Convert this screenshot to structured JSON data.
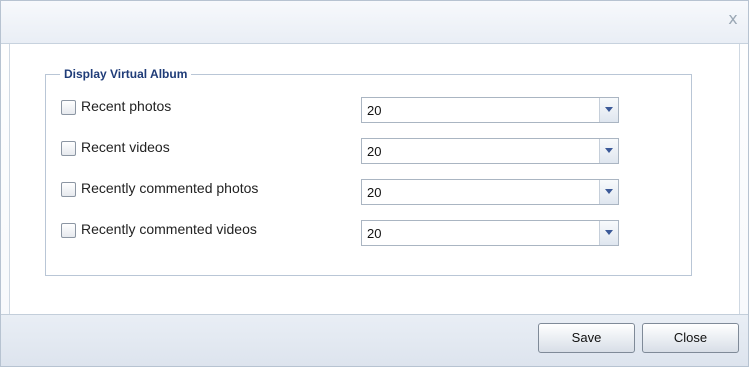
{
  "dialog": {
    "close_glyph": "x"
  },
  "album": {
    "legend": "Display Virtual Album",
    "rows": [
      {
        "label": "Recent photos",
        "count": "20"
      },
      {
        "label": "Recent videos",
        "count": "20"
      },
      {
        "label": "Recently commented photos",
        "count": "20"
      },
      {
        "label": "Recently commented videos",
        "count": "20"
      }
    ]
  },
  "footer": {
    "save_label": "Save",
    "close_label": "Close"
  }
}
